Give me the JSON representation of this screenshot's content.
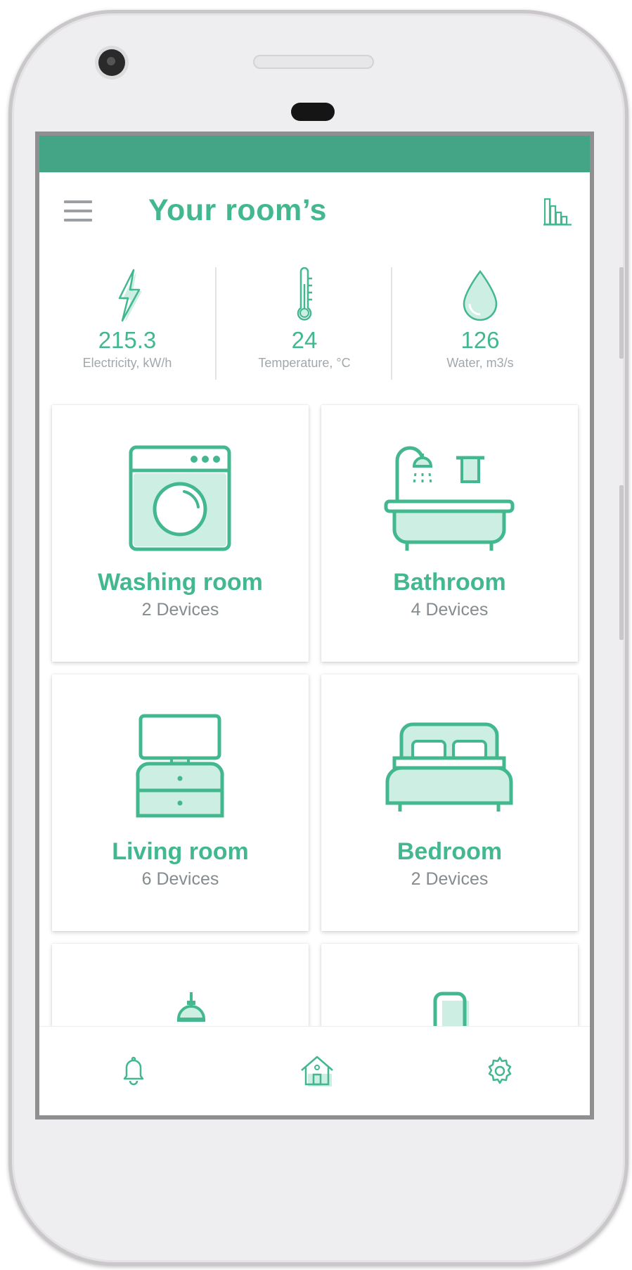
{
  "app": {
    "title": "Your room’s",
    "menu_icon": "hamburger-menu-icon",
    "stats_icon": "bar-chart-icon",
    "accent_color": "#43b88f",
    "statusbar_color": "#43a586"
  },
  "metrics": [
    {
      "icon": "lightning-bolt-icon",
      "value": "215.3",
      "label": "Electricity, kW/h"
    },
    {
      "icon": "thermometer-icon",
      "value": "24",
      "label": "Temperature, °C"
    },
    {
      "icon": "water-drop-icon",
      "value": "126",
      "label": "Water, m3/s"
    }
  ],
  "rooms": [
    {
      "icon": "washing-machine-icon",
      "name": "Washing room",
      "devices": "2 Devices"
    },
    {
      "icon": "bathtub-icon",
      "name": "Bathroom",
      "devices": "4 Devices"
    },
    {
      "icon": "tv-stand-icon",
      "name": "Living room",
      "devices": "6 Devices"
    },
    {
      "icon": "bed-icon",
      "name": "Bedroom",
      "devices": "2 Devices"
    },
    {
      "icon": "kitchen-icon"
    },
    {
      "icon": "door-icon"
    }
  ],
  "bottom_nav": [
    {
      "icon": "bell-icon"
    },
    {
      "icon": "home-icon",
      "active": true
    },
    {
      "icon": "gear-icon"
    }
  ]
}
